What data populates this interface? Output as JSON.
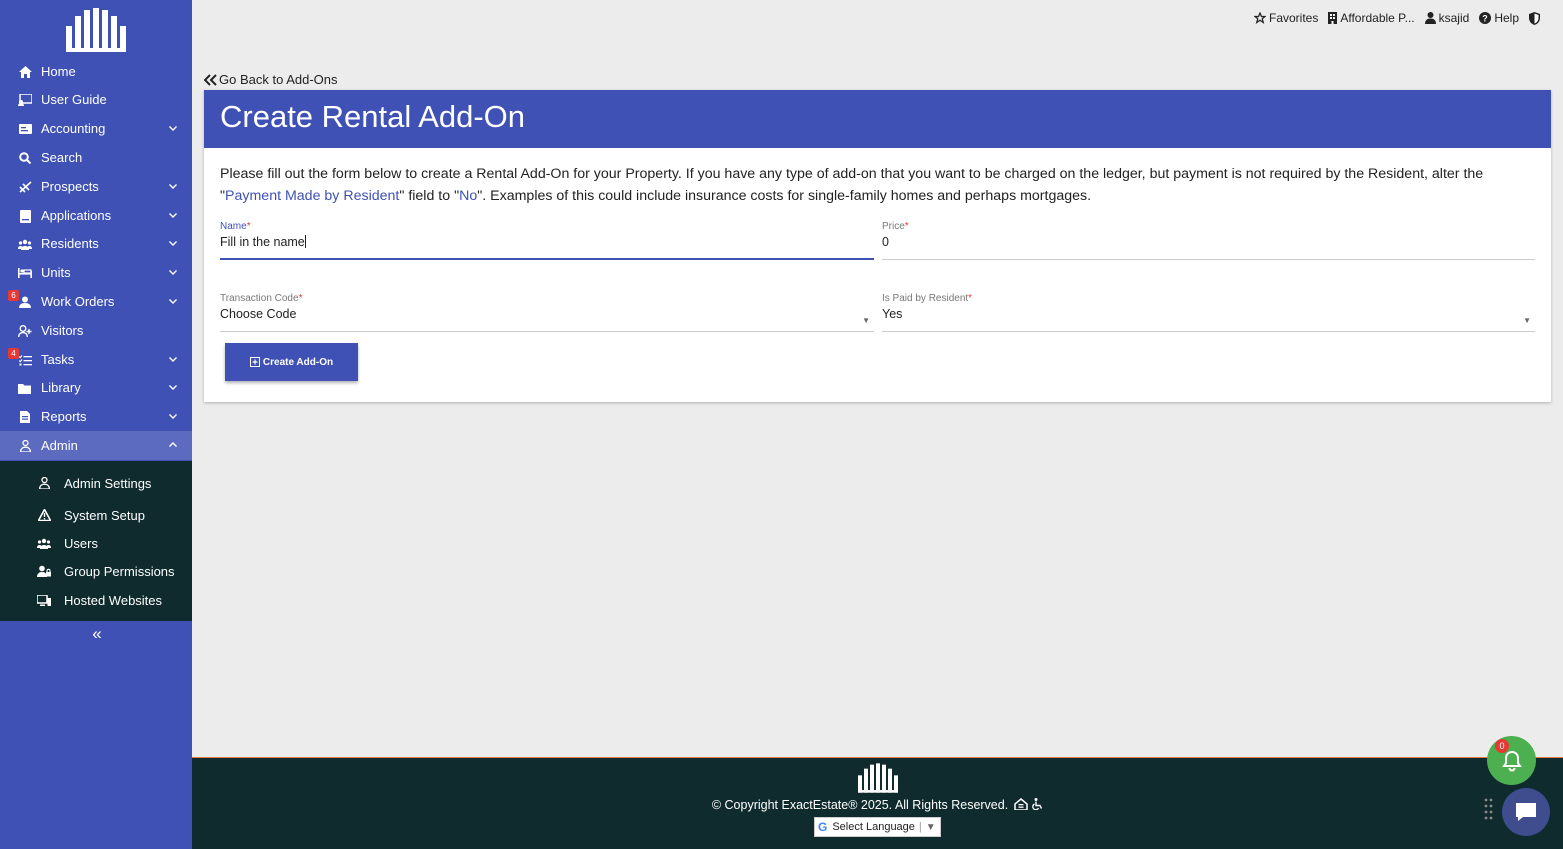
{
  "sidebar": {
    "items": [
      {
        "label": "Home",
        "icon": "home-icon",
        "expandable": false
      },
      {
        "label": "User Guide",
        "icon": "user-guide-icon",
        "expandable": false
      },
      {
        "label": "Accounting",
        "icon": "accounting-icon",
        "expandable": true
      },
      {
        "label": "Search",
        "icon": "search-icon",
        "expandable": false
      },
      {
        "label": "Prospects",
        "icon": "prospects-icon",
        "expandable": true
      },
      {
        "label": "Applications",
        "icon": "applications-icon",
        "expandable": true
      },
      {
        "label": "Residents",
        "icon": "residents-icon",
        "expandable": true
      },
      {
        "label": "Units",
        "icon": "bed-icon",
        "expandable": true
      },
      {
        "label": "Work Orders",
        "icon": "work-orders-icon",
        "expandable": true,
        "badge": "6"
      },
      {
        "label": "Visitors",
        "icon": "visitors-icon",
        "expandable": false
      },
      {
        "label": "Tasks",
        "icon": "tasks-icon",
        "expandable": true,
        "badge": "4"
      },
      {
        "label": "Library",
        "icon": "folder-icon",
        "expandable": true
      },
      {
        "label": "Reports",
        "icon": "reports-icon",
        "expandable": true
      },
      {
        "label": "Admin",
        "icon": "admin-icon",
        "expandable": true,
        "expanded": true
      }
    ],
    "admin_submenu": [
      {
        "label": "Admin Settings",
        "icon": "admin-settings-icon"
      },
      {
        "label": "System Setup",
        "icon": "warning-icon"
      },
      {
        "label": "Users",
        "icon": "users-icon"
      },
      {
        "label": "Group Permissions",
        "icon": "group-permissions-icon"
      },
      {
        "label": "Hosted Websites",
        "icon": "hosted-websites-icon"
      }
    ],
    "collapse_label": "«"
  },
  "topbar": {
    "favorites": "Favorites",
    "property": "Affordable P...",
    "user": "ksajid",
    "help": "Help"
  },
  "page": {
    "back_link": "Go Back to Add-Ons",
    "title": "Create Rental Add-On",
    "intro_part1": "Please fill out the form below to create a Rental Add-On for your Property. If you have any type of add-on that you want to be charged on the ledger, but payment is not required by the Resident, alter the \"",
    "intro_highlight1": "Payment Made by Resident",
    "intro_part2": "\" field to \"",
    "intro_highlight2": "No",
    "intro_part3": "\". Examples of this could include insurance costs for single-family homes and perhaps mortgages."
  },
  "form": {
    "name_label": "Name",
    "name_value": "Fill in the name",
    "price_label": "Price",
    "price_value": "0",
    "transaction_code_label": "Transaction Code",
    "transaction_code_value": "Choose Code",
    "paid_by_resident_label": "Is Paid by Resident",
    "paid_by_resident_value": "Yes",
    "required_mark": "*",
    "submit_label": "Create Add-On"
  },
  "footer": {
    "copyright": "© Copyright ExactEstate® 2025. All Rights Reserved.",
    "language_label": "Select Language",
    "language_arrow": "▼"
  },
  "notifications": {
    "count": "0"
  },
  "colors": {
    "primary": "#3f51b5",
    "dark": "#0f2b2d",
    "badge": "#e53935",
    "bell": "#4caf50"
  }
}
